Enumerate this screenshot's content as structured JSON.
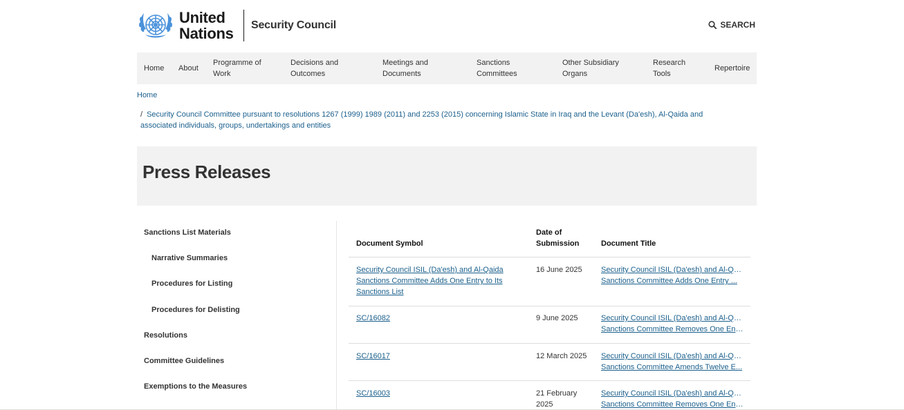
{
  "header": {
    "brand_line1": "United",
    "brand_line2": "Nations",
    "site_name": "Security Council",
    "search_label": "SEARCH"
  },
  "nav": [
    {
      "line1": "Home",
      "line2": ""
    },
    {
      "line1": "About",
      "line2": ""
    },
    {
      "line1": "Programme of",
      "line2": "Work"
    },
    {
      "line1": "Decisions and",
      "line2": "Outcomes"
    },
    {
      "line1": "Meetings and",
      "line2": "Documents"
    },
    {
      "line1": "Sanctions",
      "line2": "Committees"
    },
    {
      "line1": "Other Subsidiary",
      "line2": "Organs"
    },
    {
      "line1": "Research",
      "line2": "Tools"
    },
    {
      "line1": "Repertoire",
      "line2": ""
    }
  ],
  "breadcrumb": {
    "home": "Home",
    "separator": "/",
    "current": "Security Council Committee pursuant to resolutions 1267 (1999) 1989 (2011) and 2253 (2015) concerning Islamic State in Iraq and the Levant (Da'esh), Al-Qaida and associated individuals, groups, undertakings and entities"
  },
  "page_title": "Press Releases",
  "sidebar": [
    {
      "label": "Sanctions List Materials"
    },
    {
      "label": "Narrative Summaries"
    },
    {
      "label": "Procedures for Listing"
    },
    {
      "label": "Procedures for Delisting"
    },
    {
      "label": "Resolutions"
    },
    {
      "label": "Committee Guidelines"
    },
    {
      "label": "Exemptions to the Measures"
    }
  ],
  "table": {
    "headers": {
      "symbol": "Document Symbol",
      "date_line1": "Date of",
      "date_line2": "Submission",
      "title": "Document Title"
    },
    "rows": [
      {
        "symbol_lines": [
          "Security Council ISIL (Da'esh) and Al-Qaida",
          "Sanctions Committee Adds One Entry to Its",
          "Sanctions List"
        ],
        "date_lines": [
          "16 June 2025"
        ],
        "title_lines": [
          "Security Council ISIL (Da'esh) and Al-Qaida",
          "Sanctions Committee Adds One Entry ..."
        ]
      },
      {
        "symbol_lines": [
          "SC/16082"
        ],
        "date_lines": [
          "9 June 2025"
        ],
        "title_lines": [
          "Security Council ISIL (Da'esh) and Al-Qaida",
          "Sanctions Committee Removes One Ent..."
        ]
      },
      {
        "symbol_lines": [
          "SC/16017"
        ],
        "date_lines": [
          "12 March 2025"
        ],
        "title_lines": [
          "Security Council ISIL (Da'esh) and Al-Qaida",
          "Sanctions Committee Amends Twelve E..."
        ]
      },
      {
        "symbol_lines": [
          "SC/16003"
        ],
        "date_lines": [
          "21 February",
          "2025"
        ],
        "title_lines": [
          "Security Council ISIL (Da'esh) and Al-Qaida",
          "Sanctions Committee Removes One Ent..."
        ]
      }
    ]
  },
  "colors": {
    "link": "#1a5f8c",
    "un_blue": "#4b92db",
    "band_gray": "#f2f2f2"
  }
}
